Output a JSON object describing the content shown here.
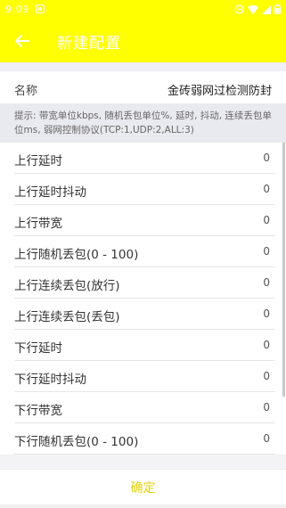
{
  "status_bar": {
    "time": "9:09"
  },
  "app_bar": {
    "title": "新建配置"
  },
  "name_field": {
    "label": "名称",
    "value": "金砖弱网过检测防封"
  },
  "hint": "提示: 带宽单位kbps, 随机丢包单位%, 延时, 抖动, 连续丢包单位ms, 弱网控制协议(TCP:1,UDP:2,ALL:3)",
  "rows": [
    {
      "label": "上行延时",
      "value": "0"
    },
    {
      "label": "上行延时抖动",
      "value": "0"
    },
    {
      "label": "上行带宽",
      "value": "0"
    },
    {
      "label": "上行随机丢包(0 - 100)",
      "value": "0"
    },
    {
      "label": "上行连续丢包(放行)",
      "value": "0"
    },
    {
      "label": "上行连续丢包(丢包)",
      "value": "0"
    },
    {
      "label": "下行延时",
      "value": "0"
    },
    {
      "label": "下行延时抖动",
      "value": "0"
    },
    {
      "label": "下行带宽",
      "value": "0"
    },
    {
      "label": "下行随机丢包(0 - 100)",
      "value": "0"
    }
  ],
  "confirm_label": "确定",
  "colors": {
    "accent": "#ffff00",
    "confirm_text": "#e6d200"
  }
}
